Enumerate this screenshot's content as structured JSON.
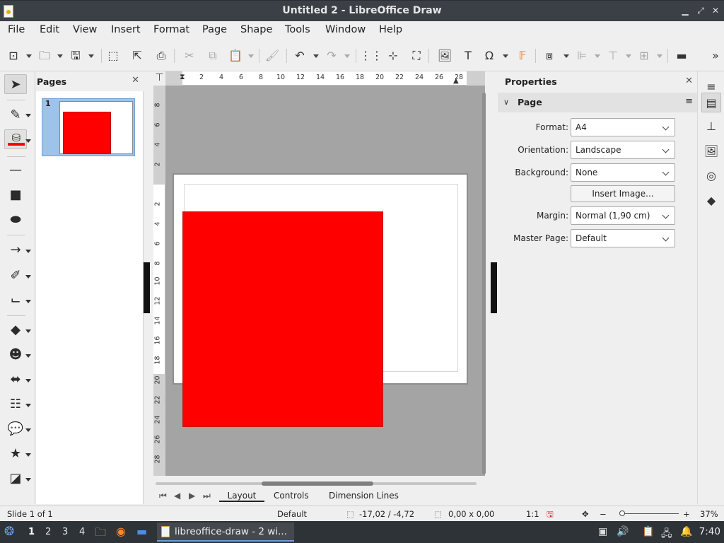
{
  "window": {
    "title": "Untitled 2 - LibreOffice Draw"
  },
  "menu": [
    "File",
    "Edit",
    "View",
    "Insert",
    "Format",
    "Page",
    "Shape",
    "Tools",
    "Window",
    "Help"
  ],
  "pages_panel": {
    "title": "Pages",
    "thumbnail_number": "1"
  },
  "ruler": {
    "h_labels": [
      "2",
      "4",
      "6",
      "8",
      "10",
      "12",
      "14",
      "16",
      "18",
      "20",
      "22",
      "24",
      "26",
      "28"
    ],
    "v_labels": [
      "8",
      "6",
      "4",
      "2",
      "2",
      "4",
      "6",
      "8",
      "10",
      "12",
      "14",
      "16",
      "18",
      "20",
      "22",
      "24",
      "26",
      "28"
    ]
  },
  "tabs": [
    "Layout",
    "Controls",
    "Dimension Lines"
  ],
  "properties": {
    "title": "Properties",
    "section": "Page",
    "format_label": "Format:",
    "format_value": "A4",
    "orientation_label": "Orientation:",
    "orientation_value": "Landscape",
    "background_label": "Background:",
    "background_value": "None",
    "insert_image": "Insert Image...",
    "margin_label": "Margin:",
    "margin_value": "Normal (1,90 cm)",
    "master_label": "Master Page:",
    "master_value": "Default"
  },
  "status": {
    "slide": "Slide 1 of 1",
    "layout": "Default",
    "position": "-17,02 / -4,72",
    "size": "0,00 x 0,00",
    "scale": "1:1",
    "zoom": "37%"
  },
  "taskbar": {
    "workspaces": [
      "1",
      "2",
      "3",
      "4"
    ],
    "active_task": "libreoffice-draw - 2 wi...",
    "clock": "7:40"
  },
  "colors": {
    "shape_fill": "#ff0000",
    "titlebar": "#3b4046",
    "canvas": "#a4a4a4"
  }
}
